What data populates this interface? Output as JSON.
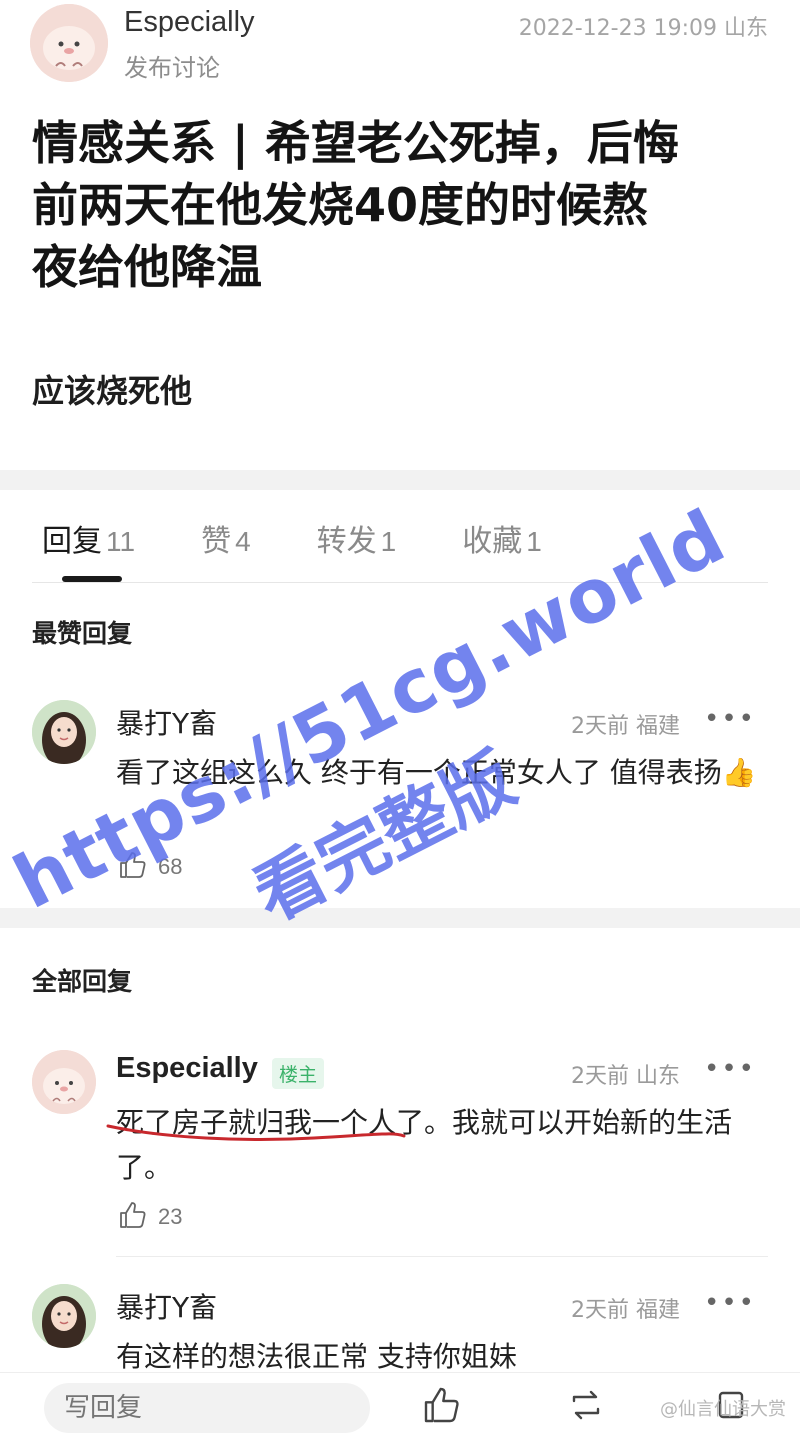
{
  "post": {
    "author": "Especially",
    "subtitle": "发布讨论",
    "meta": "2022-12-23 19:09 山东",
    "title_lines": [
      "情感关系 | 希望老公死掉，后悔",
      "前两天在他发烧40度的时候熬",
      "夜给他降温"
    ],
    "body": "应该烧死他"
  },
  "tabs": [
    {
      "label": "回复",
      "count": "11",
      "active": true
    },
    {
      "label": "赞",
      "count": "4",
      "active": false
    },
    {
      "label": "转发",
      "count": "1",
      "active": false
    },
    {
      "label": "收藏",
      "count": "1",
      "active": false
    }
  ],
  "sections": {
    "top": "最赞回复",
    "all": "全部回复"
  },
  "top_comment": {
    "name": "暴打Y畜",
    "meta": "2天前 福建",
    "more": "•••",
    "text": "看了这组这么久 终于有一个正常女人了 值得表扬👍",
    "likes": "68"
  },
  "comments": [
    {
      "name": "Especially",
      "badge": "楼主",
      "meta": "2天前 山东",
      "more": "•••",
      "text": "死了房子就归我一个人了。我就可以开始新的生活了。",
      "likes": "23"
    },
    {
      "name": "暴打Y畜",
      "meta": "2天前 福建",
      "more": "•••",
      "text": "有这样的想法很正常 支持你姐妹"
    }
  ],
  "bottom_bar": {
    "reply_placeholder": "写回复",
    "credit": "@仙言仙语大赏"
  },
  "watermark": {
    "url": "https://51cg.world",
    "cn": "看完整版"
  },
  "colors": {
    "op_badge": "#3bb26a",
    "watermark": "#5a6eeb",
    "underline": "#c8282d"
  }
}
